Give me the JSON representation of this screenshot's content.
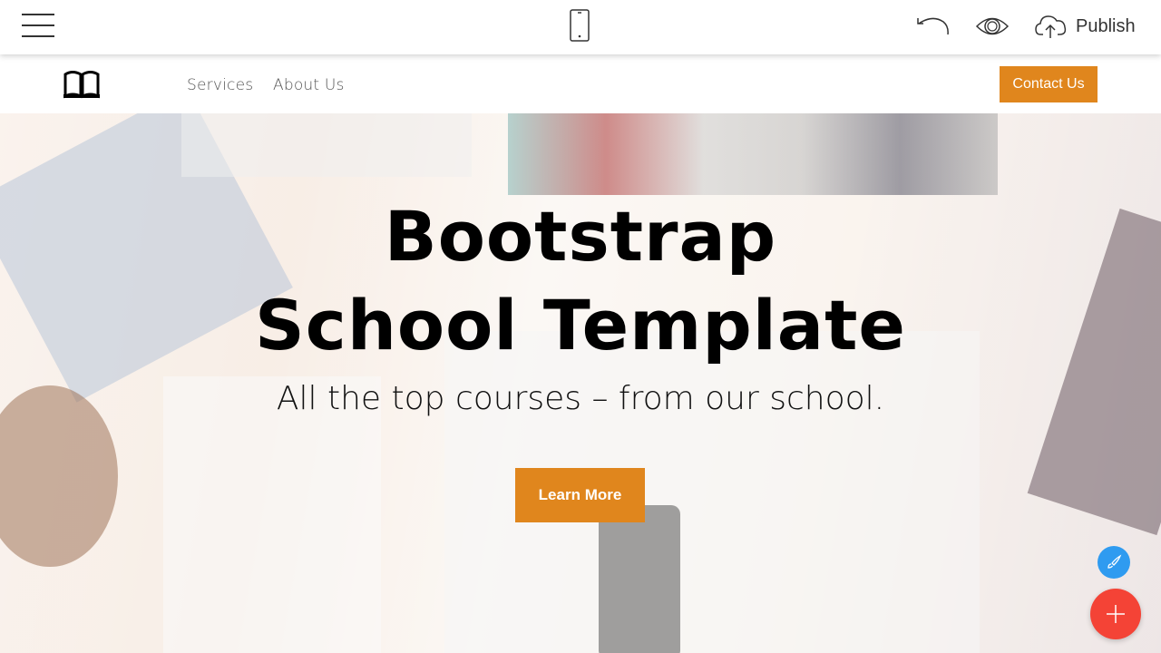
{
  "toolbar": {
    "menu_icon": "hamburger-menu-icon",
    "device_icon": "mobile-phone-icon",
    "undo_icon": "undo-icon",
    "preview_icon": "eye-icon",
    "publish_icon": "cloud-upload-icon",
    "publish_label": "Publish"
  },
  "navbar": {
    "logo_icon": "open-book-icon",
    "links": [
      {
        "label": "Services"
      },
      {
        "label": "About Us"
      }
    ],
    "contact_label": "Contact Us"
  },
  "hero": {
    "title_line1": "Bootstrap",
    "title_line2": "School Template",
    "subtitle": "All the top courses – from our school.",
    "button_label": "Learn More"
  },
  "fabs": {
    "brush_icon": "paint-brush-icon",
    "add_icon": "plus-icon"
  },
  "colors": {
    "accent": "#e0861d",
    "fab_blue": "#2f9bf0",
    "fab_red": "#f44336"
  }
}
